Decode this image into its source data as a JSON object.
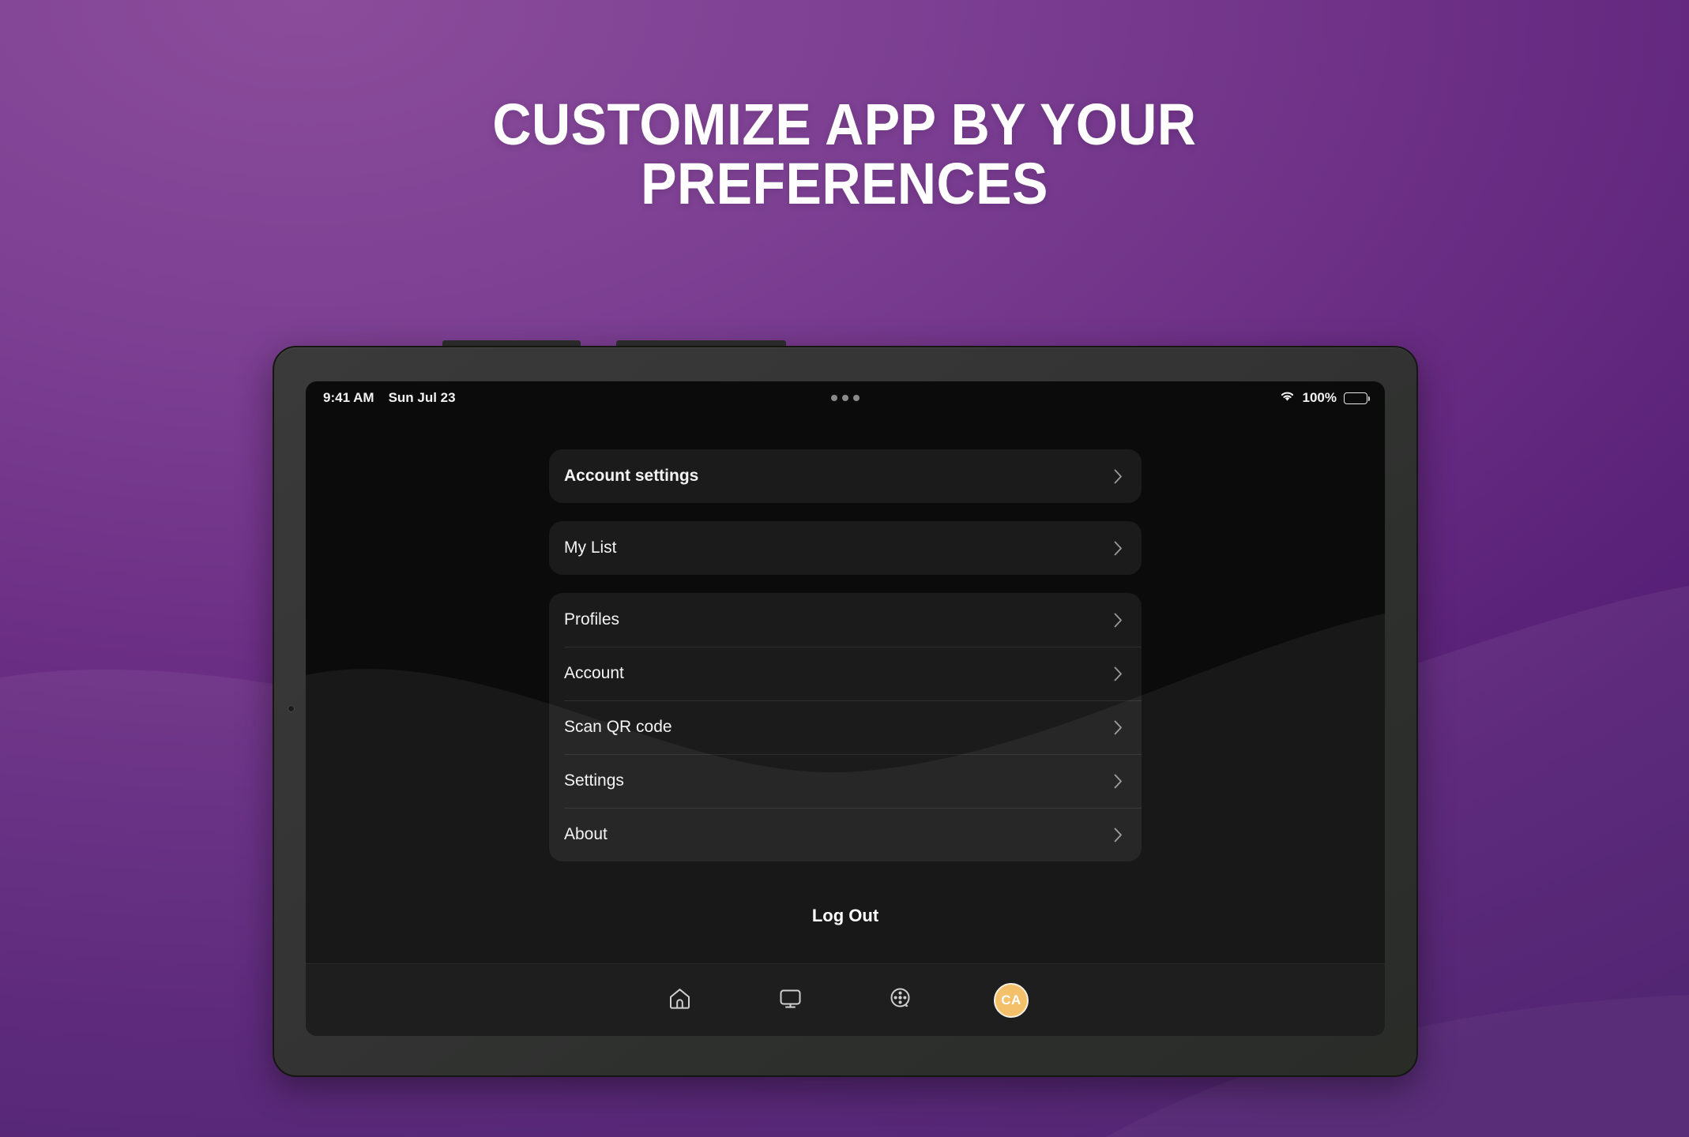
{
  "headline": {
    "text": "CUSTOMIZE APP BY YOUR\nPREFERENCES",
    "color": "#ffffff"
  },
  "theme": {
    "background_purple_light": "#8b4c9b",
    "background_purple_dark": "#4a1a6c",
    "screen_background": "#0b0b0b",
    "card_background": "#1b1b1b",
    "navbar_background": "#1e1e1e",
    "text_primary": "#f4f4f4",
    "avatar_accent": "#f5c06a"
  },
  "status_bar": {
    "time": "9:41 AM",
    "date": "Sun Jul 23",
    "wifi_icon": "wifi-icon",
    "battery_percent": "100%",
    "battery_icon": "battery-full-icon",
    "notch_icon": "camera-dots-icon"
  },
  "menu": {
    "primary": [
      {
        "label": "Account settings",
        "bold": true,
        "chevron": "chevron-right-icon"
      },
      {
        "label": "My List",
        "bold": false,
        "chevron": "chevron-right-icon"
      }
    ],
    "group": [
      {
        "label": "Profiles",
        "chevron": "chevron-right-icon"
      },
      {
        "label": "Account",
        "chevron": "chevron-right-icon"
      },
      {
        "label": "Scan QR code",
        "chevron": "chevron-right-icon"
      },
      {
        "label": "Settings",
        "chevron": "chevron-right-icon"
      },
      {
        "label": "About",
        "chevron": "chevron-right-icon"
      }
    ],
    "logout_label": "Log Out"
  },
  "nav_bar": {
    "items": [
      {
        "name": "home-icon",
        "label": ""
      },
      {
        "name": "tv-icon",
        "label": ""
      },
      {
        "name": "film-reel-icon",
        "label": ""
      }
    ],
    "avatar_initials": "CA"
  }
}
